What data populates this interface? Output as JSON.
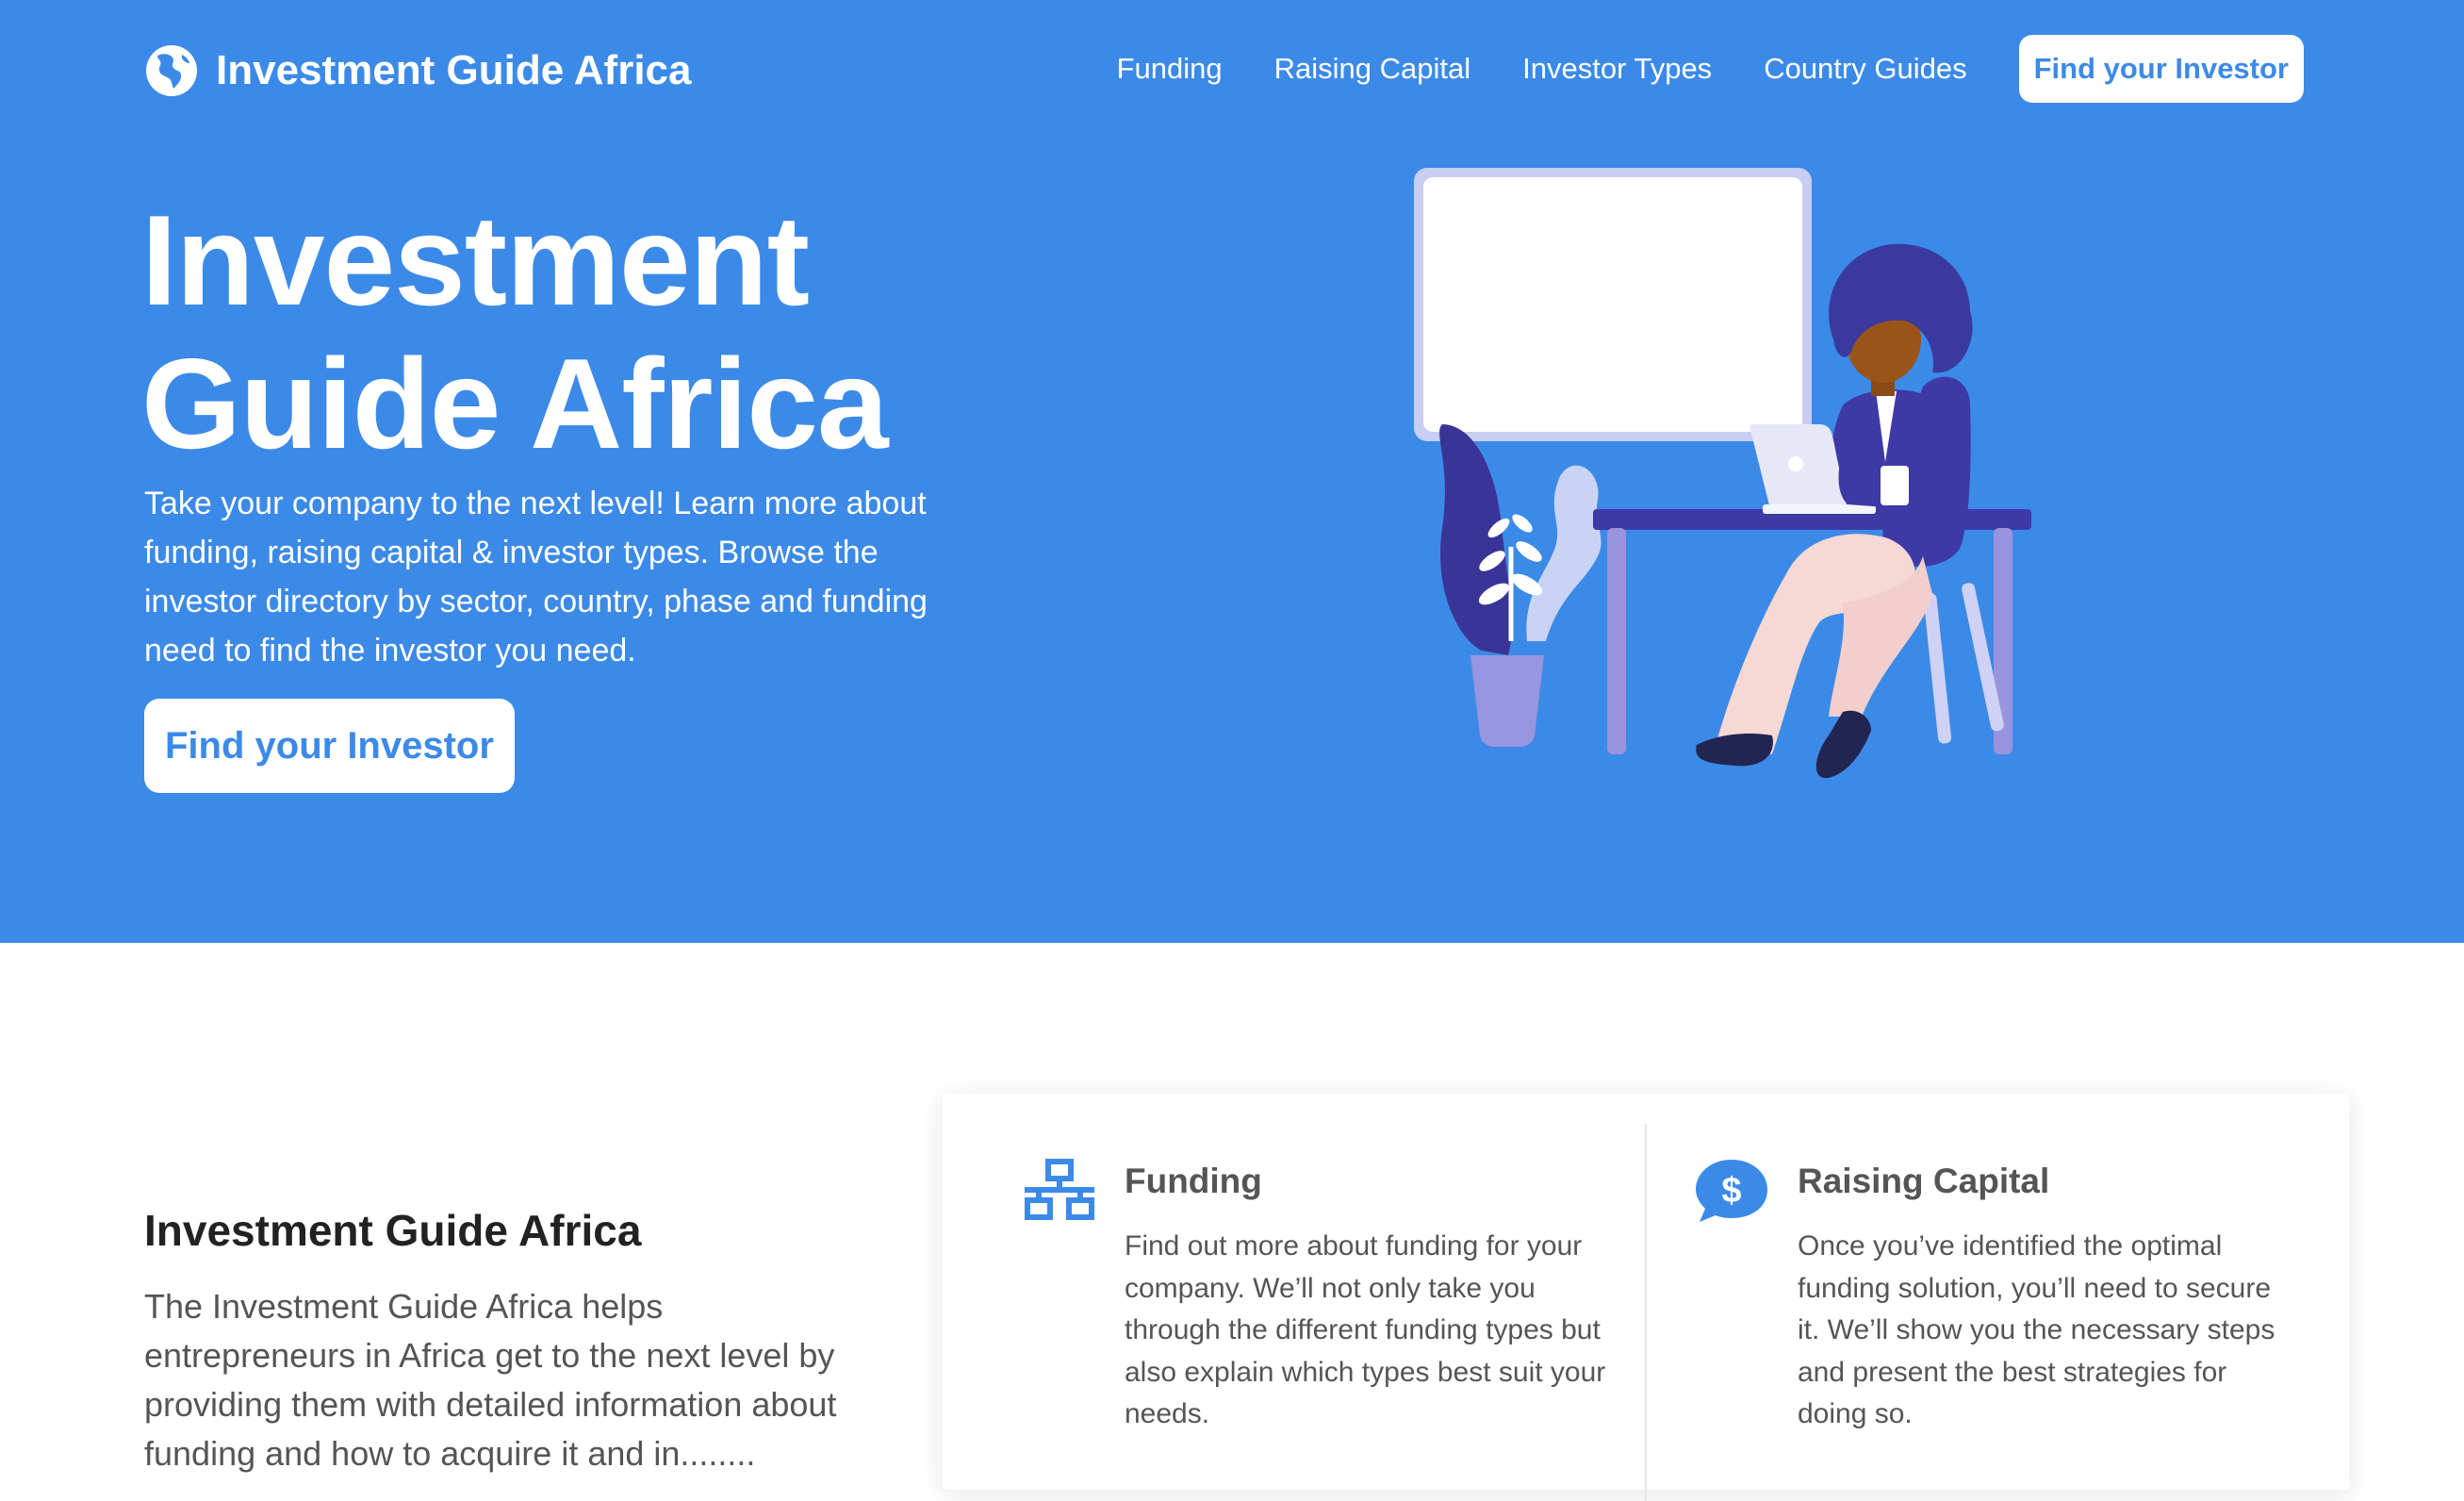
{
  "brand": {
    "name": "Investment Guide Africa",
    "primary_color": "#3c8ae8",
    "logo_icon": "globe-africa-icon"
  },
  "nav": {
    "items": [
      {
        "label": "Funding"
      },
      {
        "label": "Raising Capital"
      },
      {
        "label": "Investor Types"
      },
      {
        "label": "Country Guides"
      }
    ],
    "cta_label": "Find your Investor"
  },
  "hero": {
    "title": "Investment Guide Africa",
    "subtitle": "Take your company to the next level! Learn more about funding, raising capital & investor types. Browse the investor directory by sector, country, phase and funding need to find the investor you need.",
    "button_label": "Find your Investor",
    "illustration": "woman-at-desk-with-laptop-illustration"
  },
  "intro": {
    "title": "Investment Guide Africa",
    "text": "The Investment Guide Africa helps entrepreneurs in Africa get to the next level by providing them with detailed information about funding and how to acquire it and in........"
  },
  "cards": [
    {
      "icon": "network-sitemap-icon",
      "title": "Funding",
      "text": "Find out more about funding for your company. We’ll not only take you through the different funding types but also explain which types best suit your needs."
    },
    {
      "icon": "dollar-speech-bubble-icon",
      "title": "Raising Capital",
      "text": "Once you’ve identified the optimal funding solution, you’ll need to secure it. We’ll show you the necessary steps and present the best strategies for doing so."
    }
  ]
}
